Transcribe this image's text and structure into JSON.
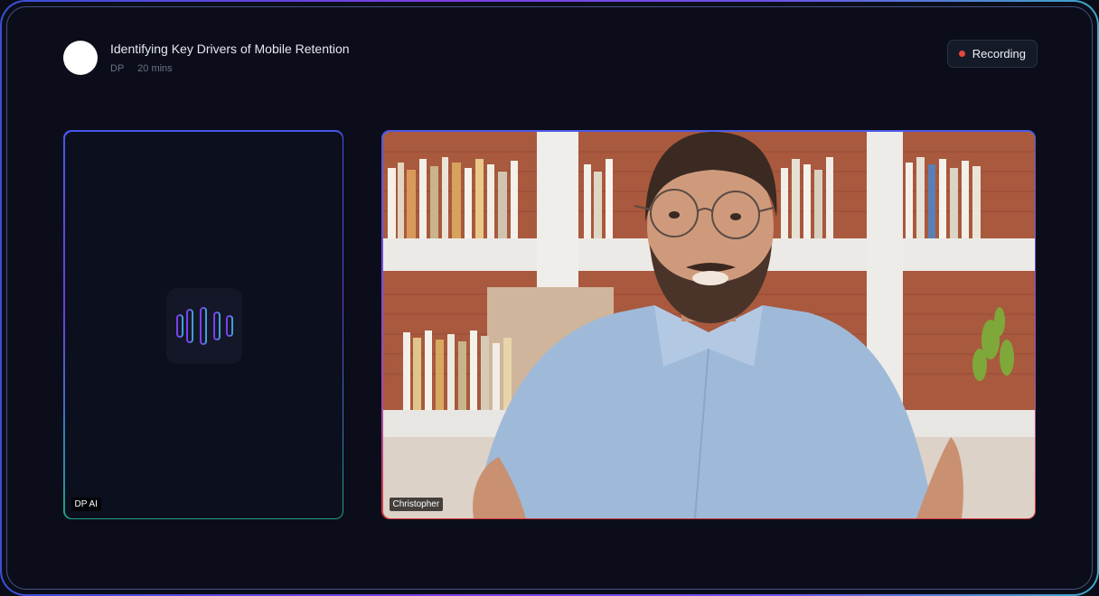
{
  "meeting": {
    "title": "Identifying Key Drivers of Mobile Retention",
    "host_initials": "DP",
    "duration": "20 mins"
  },
  "recording": {
    "label": "Recording",
    "dot_color": "#e5483d"
  },
  "participants": [
    {
      "name": "DP AI",
      "kind": "ai-assistant",
      "icon": "audio-wave-icon"
    },
    {
      "name": "Christopher",
      "kind": "video",
      "icon": "camera-feed"
    }
  ],
  "colors": {
    "background": "#0b0e1a",
    "accent_purple": "#7b3fe0",
    "accent_blue": "#3b4fd8",
    "accent_teal": "#1ea08a",
    "accent_red": "#d8383e"
  }
}
